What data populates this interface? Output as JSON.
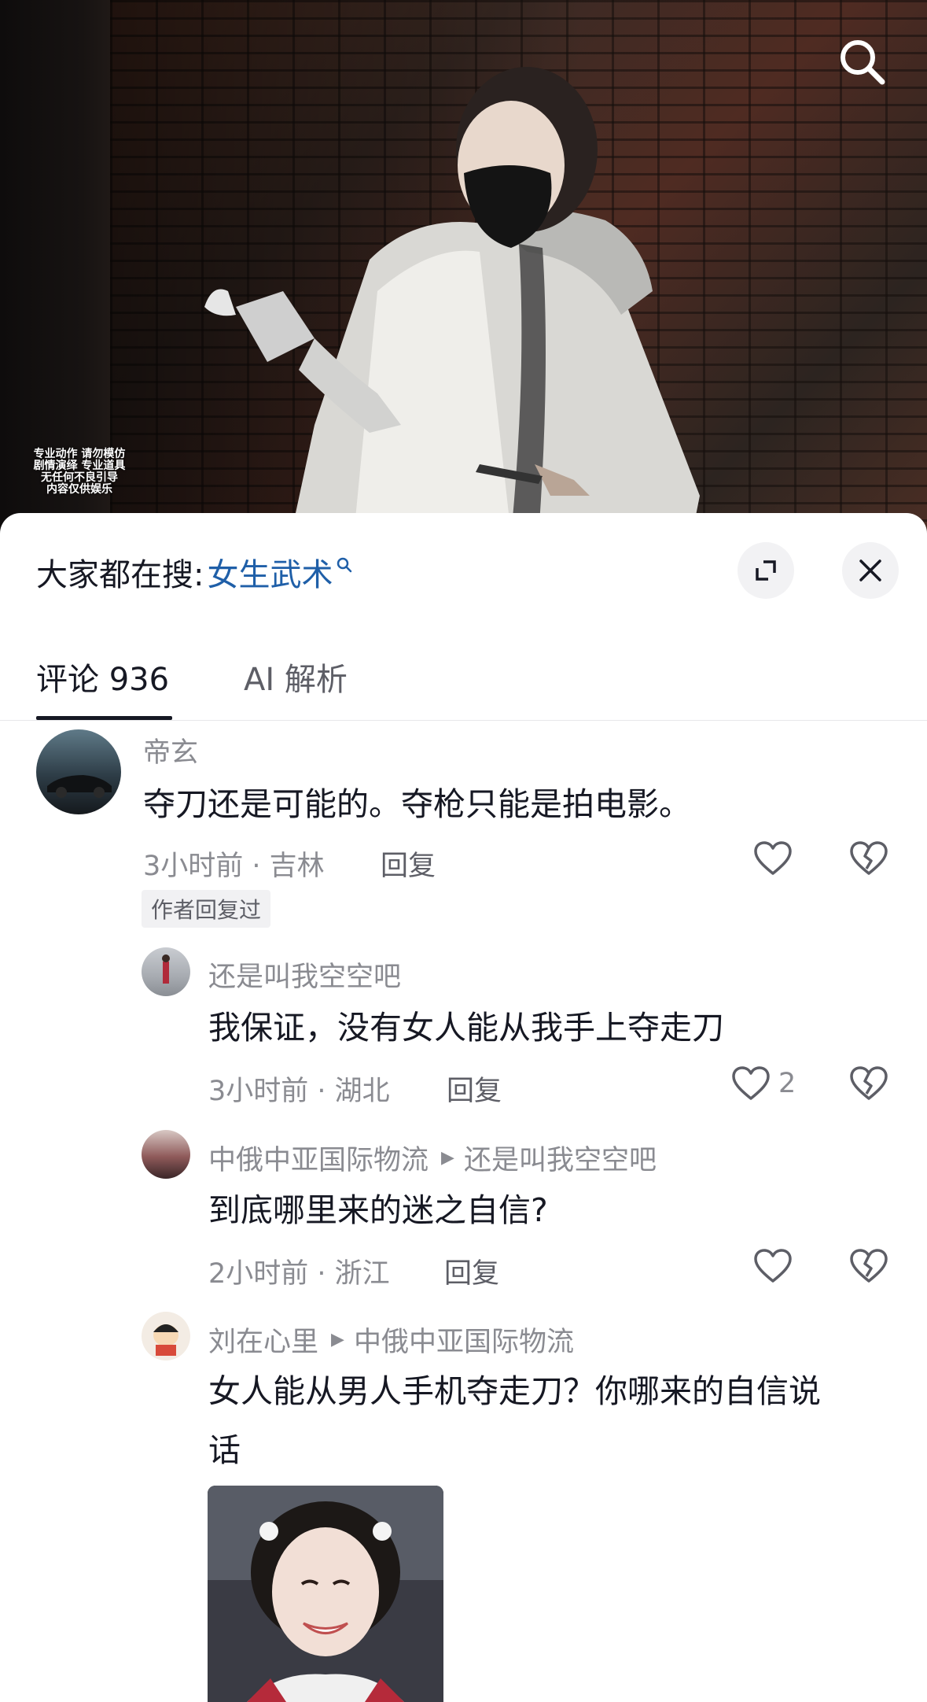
{
  "video": {
    "disclaimer_lines": [
      "专业动作 请勿模仿",
      "剧情演绎 专业道具",
      "无任何不良引导",
      "内容仅供娱乐"
    ]
  },
  "search_bar": {
    "label": "大家都在搜:",
    "keyword": "女生武术"
  },
  "tabs": [
    {
      "label": "评论 936",
      "active": true
    },
    {
      "label": "AI 解析",
      "active": false
    }
  ],
  "comments": [
    {
      "username": "帝玄",
      "text": "夺刀还是可能的。夺枪只能是拍电影。",
      "meta": "3小时前 · 吉林",
      "reply_label": "回复",
      "badge": "作者回复过"
    },
    {
      "username": "还是叫我空空吧",
      "text": "我保证，没有女人能从我手上夺走刀",
      "meta": "3小时前 · 湖北",
      "reply_label": "回复",
      "like_count": "2"
    },
    {
      "username": "中俄中亚国际物流",
      "reply_to": "还是叫我空空吧",
      "text": "到底哪里来的迷之自信?",
      "meta": "2小时前 · 浙江",
      "reply_label": "回复"
    },
    {
      "username": "刘在心里",
      "reply_to": "中俄中亚国际物流",
      "text_line1": "女人能从男人手机夺走刀？你哪来的自信说",
      "text_line2": "话"
    }
  ],
  "colors": {
    "accent_link": "#1f5fa8",
    "text_primary": "#161823",
    "text_secondary": "#8a8b91"
  },
  "icons": [
    "search-icon",
    "search-mini-icon",
    "expand-icon",
    "close-icon",
    "heart-icon",
    "broken-heart-icon",
    "triangle-arrow-icon"
  ]
}
